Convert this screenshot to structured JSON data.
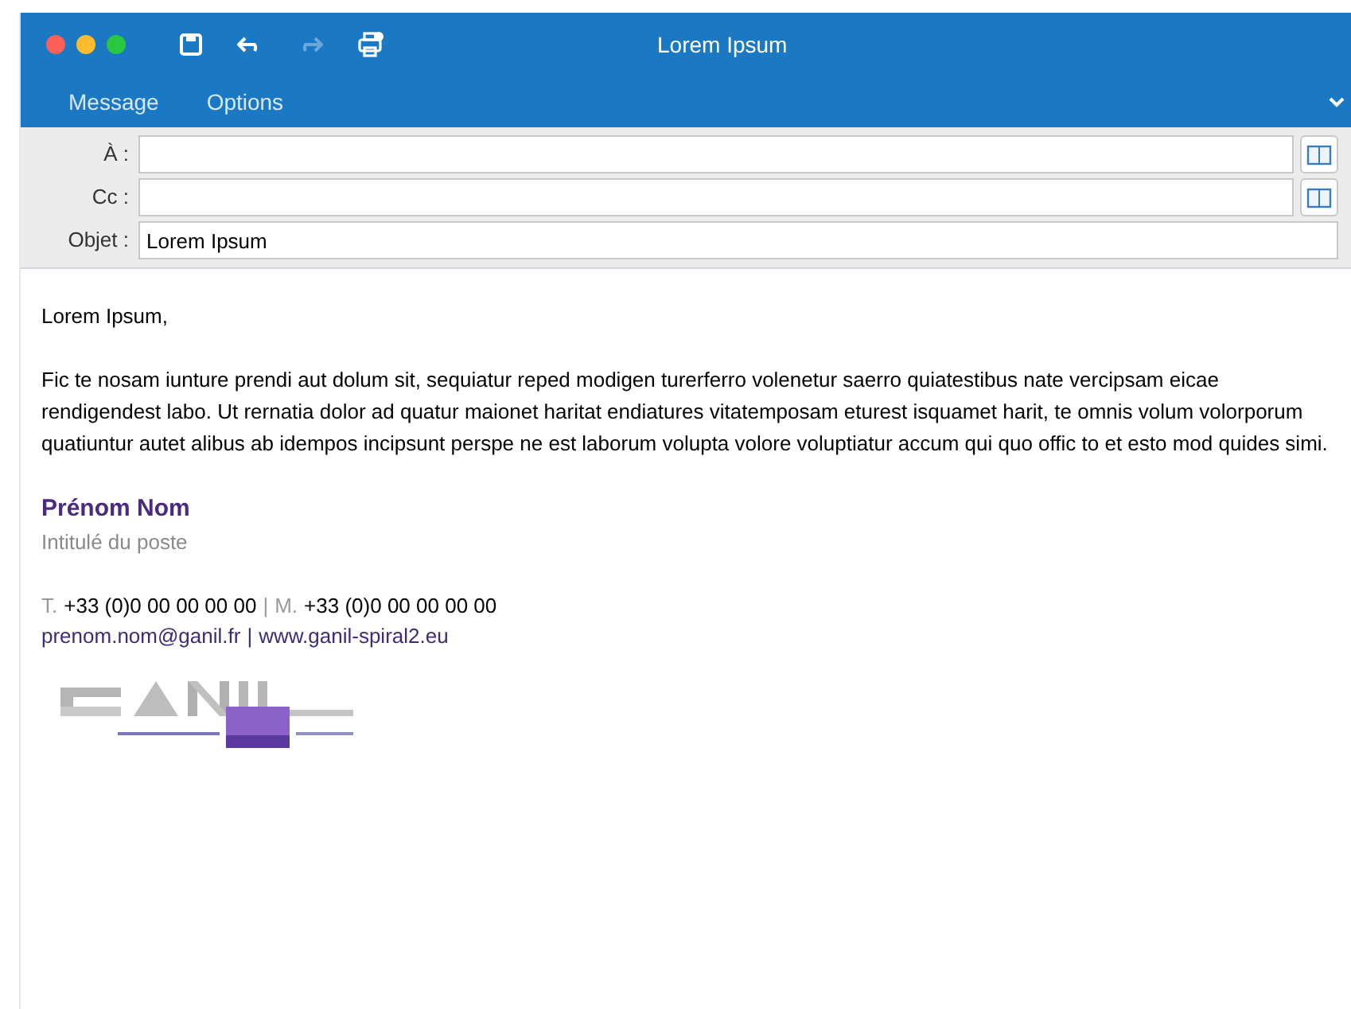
{
  "window": {
    "title": "Lorem Ipsum"
  },
  "ribbon_tabs": [
    {
      "label": "Message"
    },
    {
      "label": "Options"
    }
  ],
  "fields": [
    {
      "label": "À :",
      "kind": "recipient"
    },
    {
      "label": "Cc :",
      "kind": "recipient"
    },
    {
      "label": "Objet :",
      "kind": "subject",
      "value": "Lorem Ipsum"
    }
  ],
  "body": {
    "greeting": "Lorem Ipsum,",
    "paragraph": "Fic te nosam iunture prendi aut dolum sit, sequiatur reped modigen turerferro volenetur saerro quiatestibus nate vercipsam eicae rendigendest labo. Ut rernatia dolor ad quatur maionet haritat endiatures vitatemposam eturest isquamet harit, te omnis volum volorporum quatiuntur autet alibus ab idempos incipsunt perspe ne est laborum volupta volore voluptiatur accum qui quo offic to et esto mod quides simi."
  },
  "signature": {
    "name": "Prénom Nom",
    "job_title": "Intitulé du poste",
    "phone_label": "T.",
    "phone": "+33 (0)0 00 00 00 00",
    "separator": "|",
    "mobile_label": "M.",
    "mobile": "+33 (0)0 00 00 00 00",
    "email": "prenom.nom@ganil.fr",
    "separator_2": "|",
    "website": "www.ganil-spiral2.eu"
  }
}
